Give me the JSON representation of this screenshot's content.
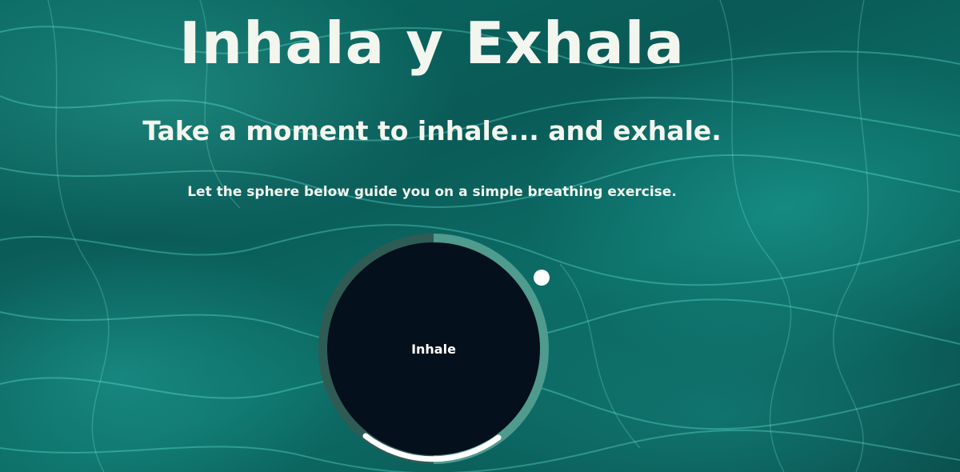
{
  "page": {
    "title": "Inhala y Exhala",
    "subtitle": "Take a moment to inhale... and exhale.",
    "description": "Let the sphere below guide you on a simple breathing exercise."
  },
  "sphere": {
    "label": "Inhale",
    "ring_colors": {
      "dark_half": "#2f5b55",
      "light_half": "#4f9b8d",
      "progress": "#ffffff",
      "core": "#04101b"
    },
    "pointer_icon": "pointer-dot-icon"
  },
  "colors": {
    "water_base": "#0a5a57",
    "water_highlight": "#46dcc8",
    "text": "#f3f6ee"
  }
}
